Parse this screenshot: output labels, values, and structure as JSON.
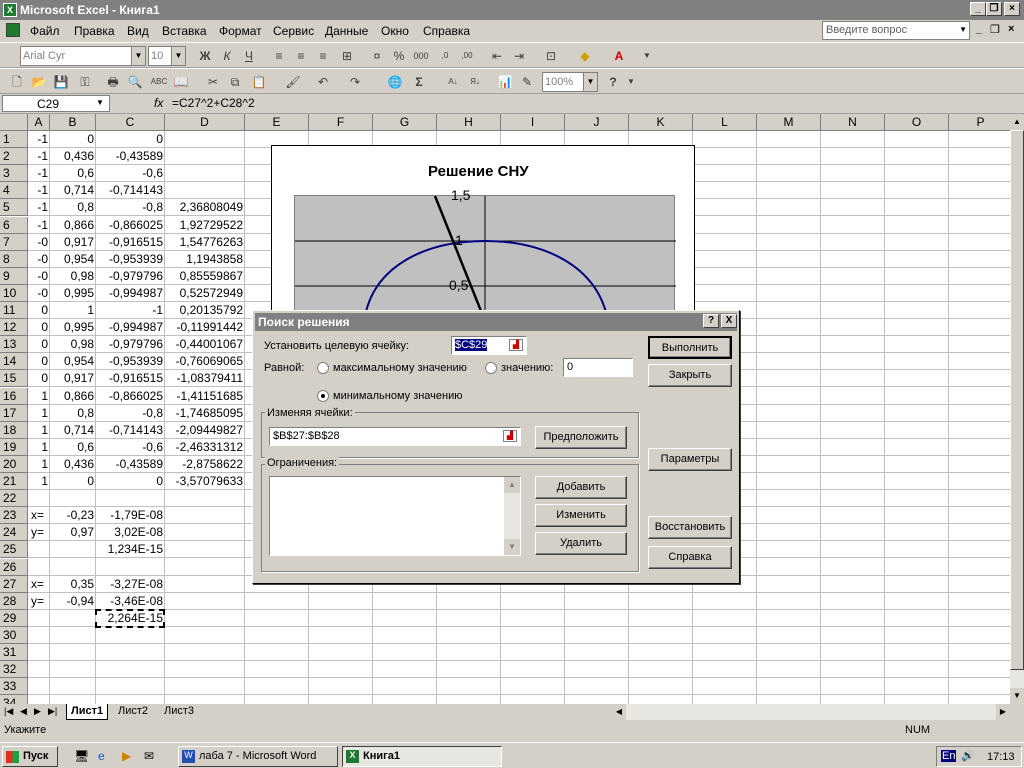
{
  "window": {
    "title": "Microsoft Excel - Книга1"
  },
  "menu": [
    "Файл",
    "Правка",
    "Вид",
    "Вставка",
    "Формат",
    "Сервис",
    "Данные",
    "Окно",
    "Справка"
  ],
  "help_placeholder": "Введите вопрос",
  "toolbar": {
    "font": "Arial Cyr",
    "size": "10",
    "zoom": "100%"
  },
  "formula_bar": {
    "cell": "C29",
    "fx": "fx",
    "formula": "=C27^2+C28^2"
  },
  "columns": [
    "A",
    "B",
    "C",
    "D",
    "E",
    "F",
    "G",
    "H",
    "I",
    "J",
    "K",
    "L",
    "M",
    "N",
    "O",
    "P"
  ],
  "rows": [
    {
      "n": "1",
      "a": "-1",
      "b": "0",
      "c": "0",
      "d": ""
    },
    {
      "n": "2",
      "a": "-1",
      "b": "0,436",
      "c": "-0,43589",
      "d": ""
    },
    {
      "n": "3",
      "a": "-1",
      "b": "0,6",
      "c": "-0,6",
      "d": ""
    },
    {
      "n": "4",
      "a": "-1",
      "b": "0,714",
      "c": "-0,714143",
      "d": ""
    },
    {
      "n": "5",
      "a": "-1",
      "b": "0,8",
      "c": "-0,8",
      "d": "2,36808049"
    },
    {
      "n": "6",
      "a": "-1",
      "b": "0,866",
      "c": "-0,866025",
      "d": "1,92729522"
    },
    {
      "n": "7",
      "a": "-0",
      "b": "0,917",
      "c": "-0,916515",
      "d": "1,54776263"
    },
    {
      "n": "8",
      "a": "-0",
      "b": "0,954",
      "c": "-0,953939",
      "d": "1,1943858"
    },
    {
      "n": "9",
      "a": "-0",
      "b": "0,98",
      "c": "-0,979796",
      "d": "0,85559867"
    },
    {
      "n": "10",
      "a": "-0",
      "b": "0,995",
      "c": "-0,994987",
      "d": "0,52572949"
    },
    {
      "n": "11",
      "a": "0",
      "b": "1",
      "c": "-1",
      "d": "0,20135792"
    },
    {
      "n": "12",
      "a": "0",
      "b": "0,995",
      "c": "-0,994987",
      "d": "-0,11991442"
    },
    {
      "n": "13",
      "a": "0",
      "b": "0,98",
      "c": "-0,979796",
      "d": "-0,44001067"
    },
    {
      "n": "14",
      "a": "0",
      "b": "0,954",
      "c": "-0,953939",
      "d": "-0,76069065"
    },
    {
      "n": "15",
      "a": "0",
      "b": "0,917",
      "c": "-0,916515",
      "d": "-1,08379411"
    },
    {
      "n": "16",
      "a": "1",
      "b": "0,866",
      "c": "-0,866025",
      "d": "-1,41151685"
    },
    {
      "n": "17",
      "a": "1",
      "b": "0,8",
      "c": "-0,8",
      "d": "-1,74685095"
    },
    {
      "n": "18",
      "a": "1",
      "b": "0,714",
      "c": "-0,714143",
      "d": "-2,09449827"
    },
    {
      "n": "19",
      "a": "1",
      "b": "0,6",
      "c": "-0,6",
      "d": "-2,46331312"
    },
    {
      "n": "20",
      "a": "1",
      "b": "0,436",
      "c": "-0,43589",
      "d": "-2,8758622"
    },
    {
      "n": "21",
      "a": "1",
      "b": "0",
      "c": "0",
      "d": "-3,57079633"
    },
    {
      "n": "22",
      "a": "",
      "b": "",
      "c": "",
      "d": ""
    },
    {
      "n": "23",
      "a": "x=",
      "b": "-0,23",
      "c": "-1,79E-08",
      "d": ""
    },
    {
      "n": "24",
      "a": "y=",
      "b": "0,97",
      "c": "3,02E-08",
      "d": ""
    },
    {
      "n": "25",
      "a": "",
      "b": "",
      "c": "1,234E-15",
      "d": ""
    },
    {
      "n": "26",
      "a": "",
      "b": "",
      "c": "",
      "d": ""
    },
    {
      "n": "27",
      "a": "x=",
      "b": "0,35",
      "c": "-3,27E-08",
      "d": ""
    },
    {
      "n": "28",
      "a": "y=",
      "b": "-0,94",
      "c": "-3,46E-08",
      "d": ""
    },
    {
      "n": "29",
      "a": "",
      "b": "",
      "c": "2,264E-15",
      "d": ""
    },
    {
      "n": "30",
      "a": "",
      "b": "",
      "c": "",
      "d": ""
    },
    {
      "n": "31",
      "a": "",
      "b": "",
      "c": "",
      "d": ""
    },
    {
      "n": "32",
      "a": "",
      "b": "",
      "c": "",
      "d": ""
    },
    {
      "n": "33",
      "a": "",
      "b": "",
      "c": "",
      "d": ""
    },
    {
      "n": "34",
      "a": "",
      "b": "",
      "c": "",
      "d": ""
    }
  ],
  "chart": {
    "title": "Решение СНУ",
    "ticks": [
      "1,5",
      "1",
      "0,5"
    ]
  },
  "solver": {
    "title": "Поиск решения",
    "target_label": "Установить целевую ячейку:",
    "target_value": "$C$29",
    "equal_label": "Равной:",
    "opt_max": "максимальному значению",
    "opt_value": "значению:",
    "value": "0",
    "opt_min": "минимальному значению",
    "changing_label": "Изменяя ячейки:",
    "changing_value": "$B$27:$B$28",
    "guess": "Предположить",
    "constraints_label": "Ограничения:",
    "add": "Добавить",
    "change": "Изменить",
    "delete": "Удалить",
    "run": "Выполнить",
    "close": "Закрыть",
    "params": "Параметры",
    "restore": "Восстановить",
    "help": "Справка",
    "help_q": "?",
    "close_x": "X"
  },
  "sheets": [
    "Лист1",
    "Лист2",
    "Лист3"
  ],
  "status": {
    "left": "Укажите",
    "num": "NUM"
  },
  "taskbar": {
    "start": "Пуск",
    "tasks": [
      "лаба 7 - Microsoft Word",
      "Книга1"
    ],
    "lang": "En",
    "time": "17:13"
  }
}
